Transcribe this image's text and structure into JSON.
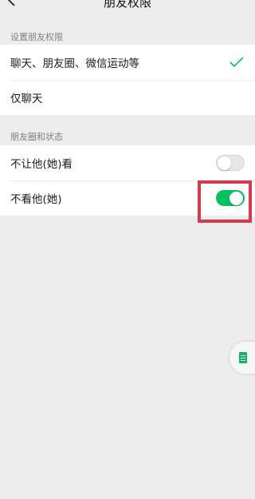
{
  "header": {
    "title": "朋友权限",
    "back_icon": "chevron-left-icon"
  },
  "permissions": {
    "section_label": "设置朋友权限",
    "options": [
      {
        "label": "聊天、朋友圈、微信运动等",
        "selected": true
      },
      {
        "label": "仅聊天",
        "selected": false
      }
    ]
  },
  "moments": {
    "section_label": "朋友圈和状态",
    "toggles": [
      {
        "label": "不让他(她)看",
        "on": false
      },
      {
        "label": "不看他(她)",
        "on": true
      }
    ]
  },
  "colors": {
    "accent": "#07c160",
    "highlight": "#d43a4b",
    "background": "#ededed"
  },
  "floating_button": {
    "icon": "document-icon"
  }
}
